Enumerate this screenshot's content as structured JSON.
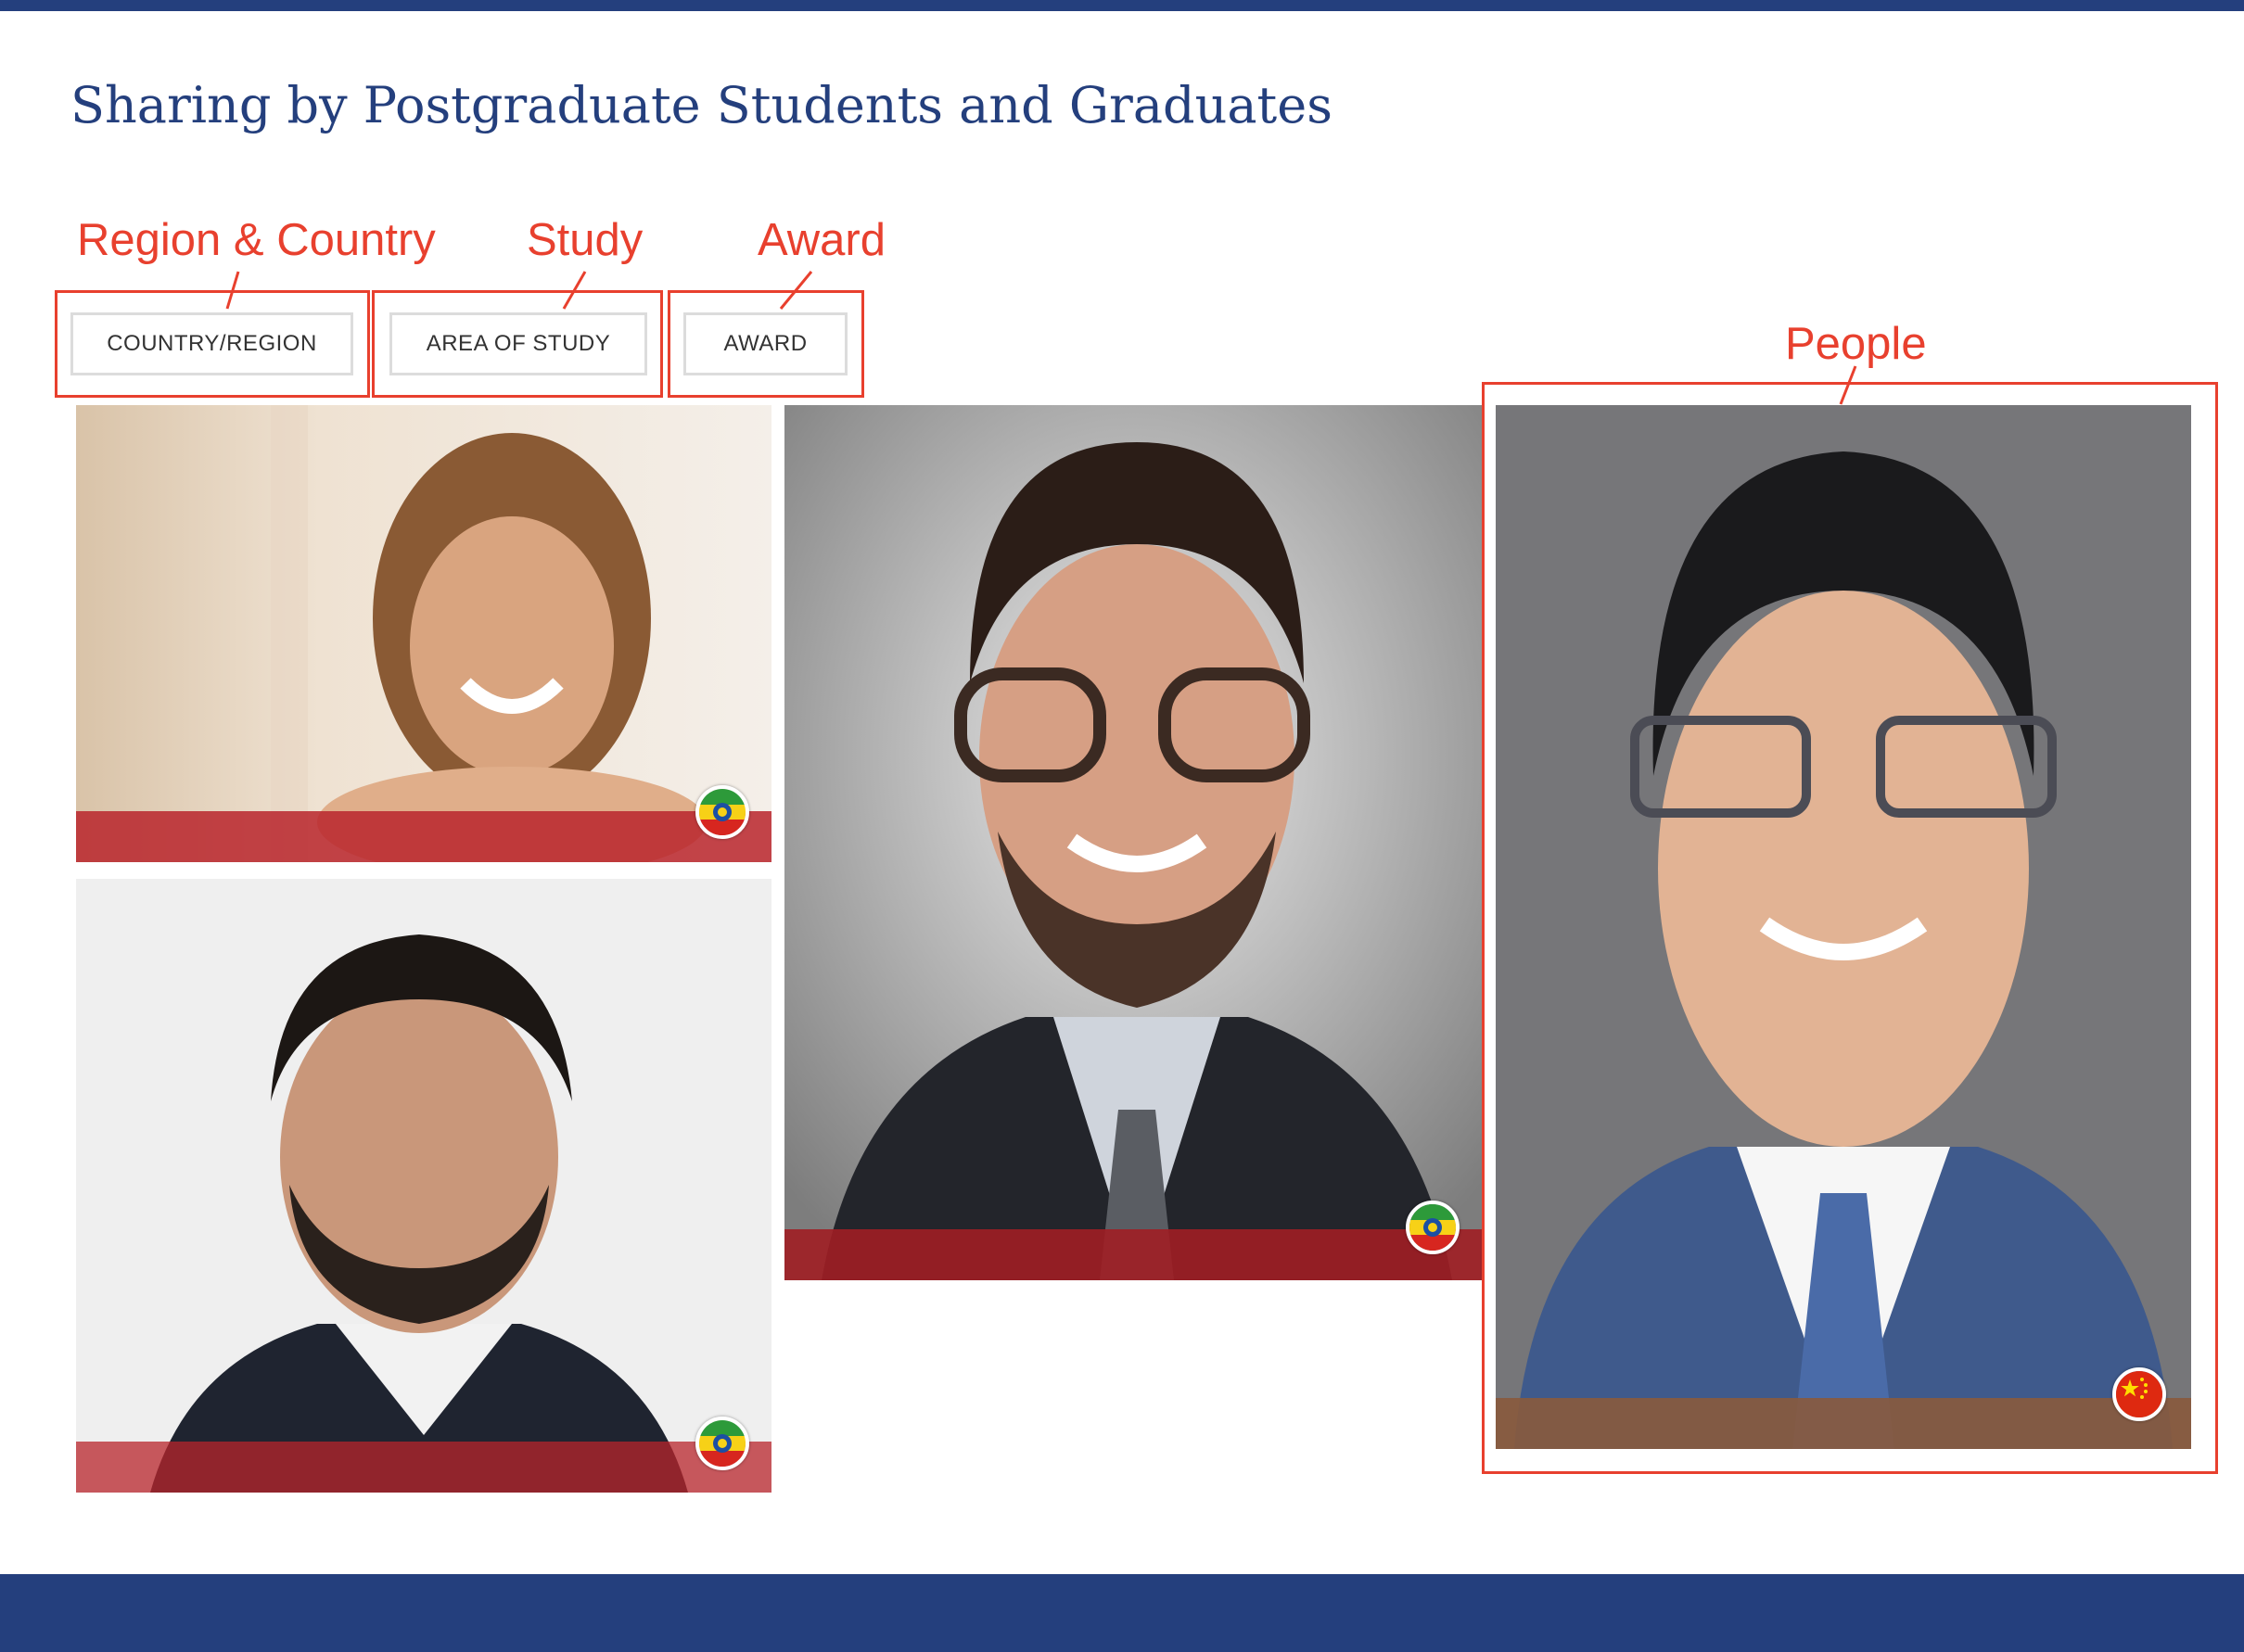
{
  "header": {
    "title": "Sharing by  Postgraduate Students and Graduates"
  },
  "filters": {
    "country_region": "COUNTRY/REGION",
    "area_of_study": "AREA OF STUDY",
    "award": "AWARD"
  },
  "annotations": {
    "region_country": "Region & Country",
    "study": "Study",
    "award": "Award",
    "people": "People"
  },
  "people": [
    {
      "flag": "ethiopia-flag-icon"
    },
    {
      "flag": "ethiopia-flag-icon"
    },
    {
      "flag": "ethiopia-flag-icon"
    },
    {
      "flag": "china-flag-icon"
    }
  ],
  "colors": {
    "brand_navy": "#243f7d",
    "annotation_red": "#e8402e",
    "card_band_red": "#b8242b",
    "card_band_brown": "#8a5a3c"
  }
}
